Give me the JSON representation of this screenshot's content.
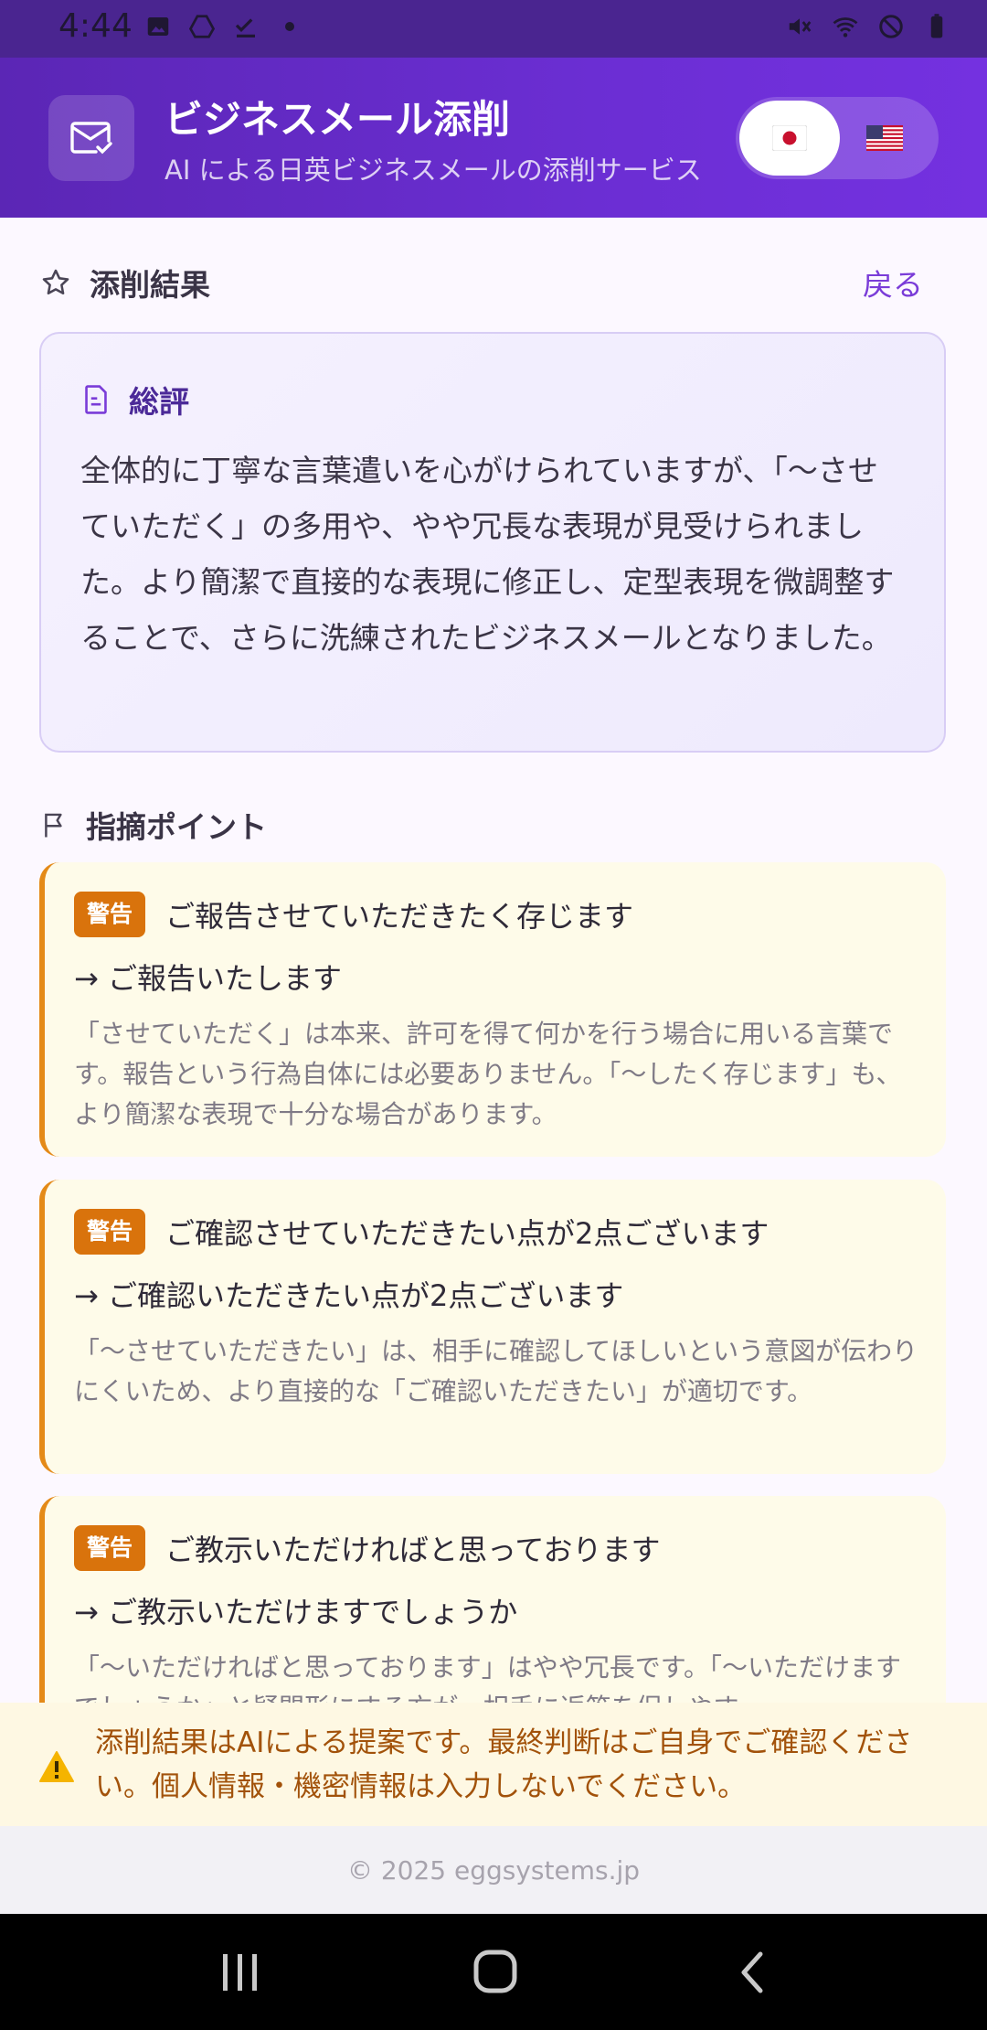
{
  "status_bar": {
    "time": "4:44"
  },
  "header": {
    "title": "ビジネスメール添削",
    "subtitle": "AI による日英ビジネスメールの添削サービス",
    "lang_ja_flag": "🇯🇵",
    "lang_en_flag": "🇺🇸"
  },
  "result": {
    "title": "添削結果",
    "back_label": "戻る"
  },
  "summary": {
    "title": "総評",
    "body": "全体的に丁寧な言葉遣いを心がけられていますが、「〜させていただく」の多用や、やや冗長な表現が見受けられました。より簡潔で直接的な表現に修正し、定型表現を微調整することで、さらに洗練されたビジネスメールとなりました。"
  },
  "points_section": {
    "title": "指摘ポイント"
  },
  "points": [
    {
      "badge": "警告",
      "original": "ご報告させていただきたく存じます",
      "fix": "→ ご報告いたします",
      "reason": "「させていただく」は本来、許可を得て何かを行う場合に用いる言葉です。報告という行為自体には必要ありません。「〜したく存じます」も、より簡潔な表現で十分な場合があります。"
    },
    {
      "badge": "警告",
      "original": "ご確認させていただきたい点が2点ございます",
      "fix": "→ ご確認いただきたい点が2点ございます",
      "reason": "「〜させていただきたい」は、相手に確認してほしいという意図が伝わりにくいため、より直接的な「ご確認いただきたい」が適切です。"
    },
    {
      "badge": "警告",
      "original": "ご教示いただければと思っております",
      "fix": "→ ご教示いただけますでしょうか",
      "reason": "「〜いただければと思っております」はやや冗長です。「〜いただけますでしょうか」と疑問形にする方が、相手に返答を促しやす"
    }
  ],
  "notice": {
    "text": "添削結果はAIによる提案です。最終判断はご自身でご確認ください。個人情報・機密情報は入力しないでください。"
  },
  "footer": {
    "copyright": "© 2025 eggsystems.jp"
  },
  "colors": {
    "header_start": "#5b26b5",
    "header_end": "#7431e0",
    "accent": "#7a3cd8",
    "warning_badge": "#d9730c",
    "warning_border": "#e48a18",
    "notice_text": "#a2520a"
  },
  "icons": {
    "app": "mail-check-icon",
    "result": "star-icon",
    "summary": "document-icon",
    "points": "flag-icon",
    "notice": "warning-triangle-icon"
  }
}
